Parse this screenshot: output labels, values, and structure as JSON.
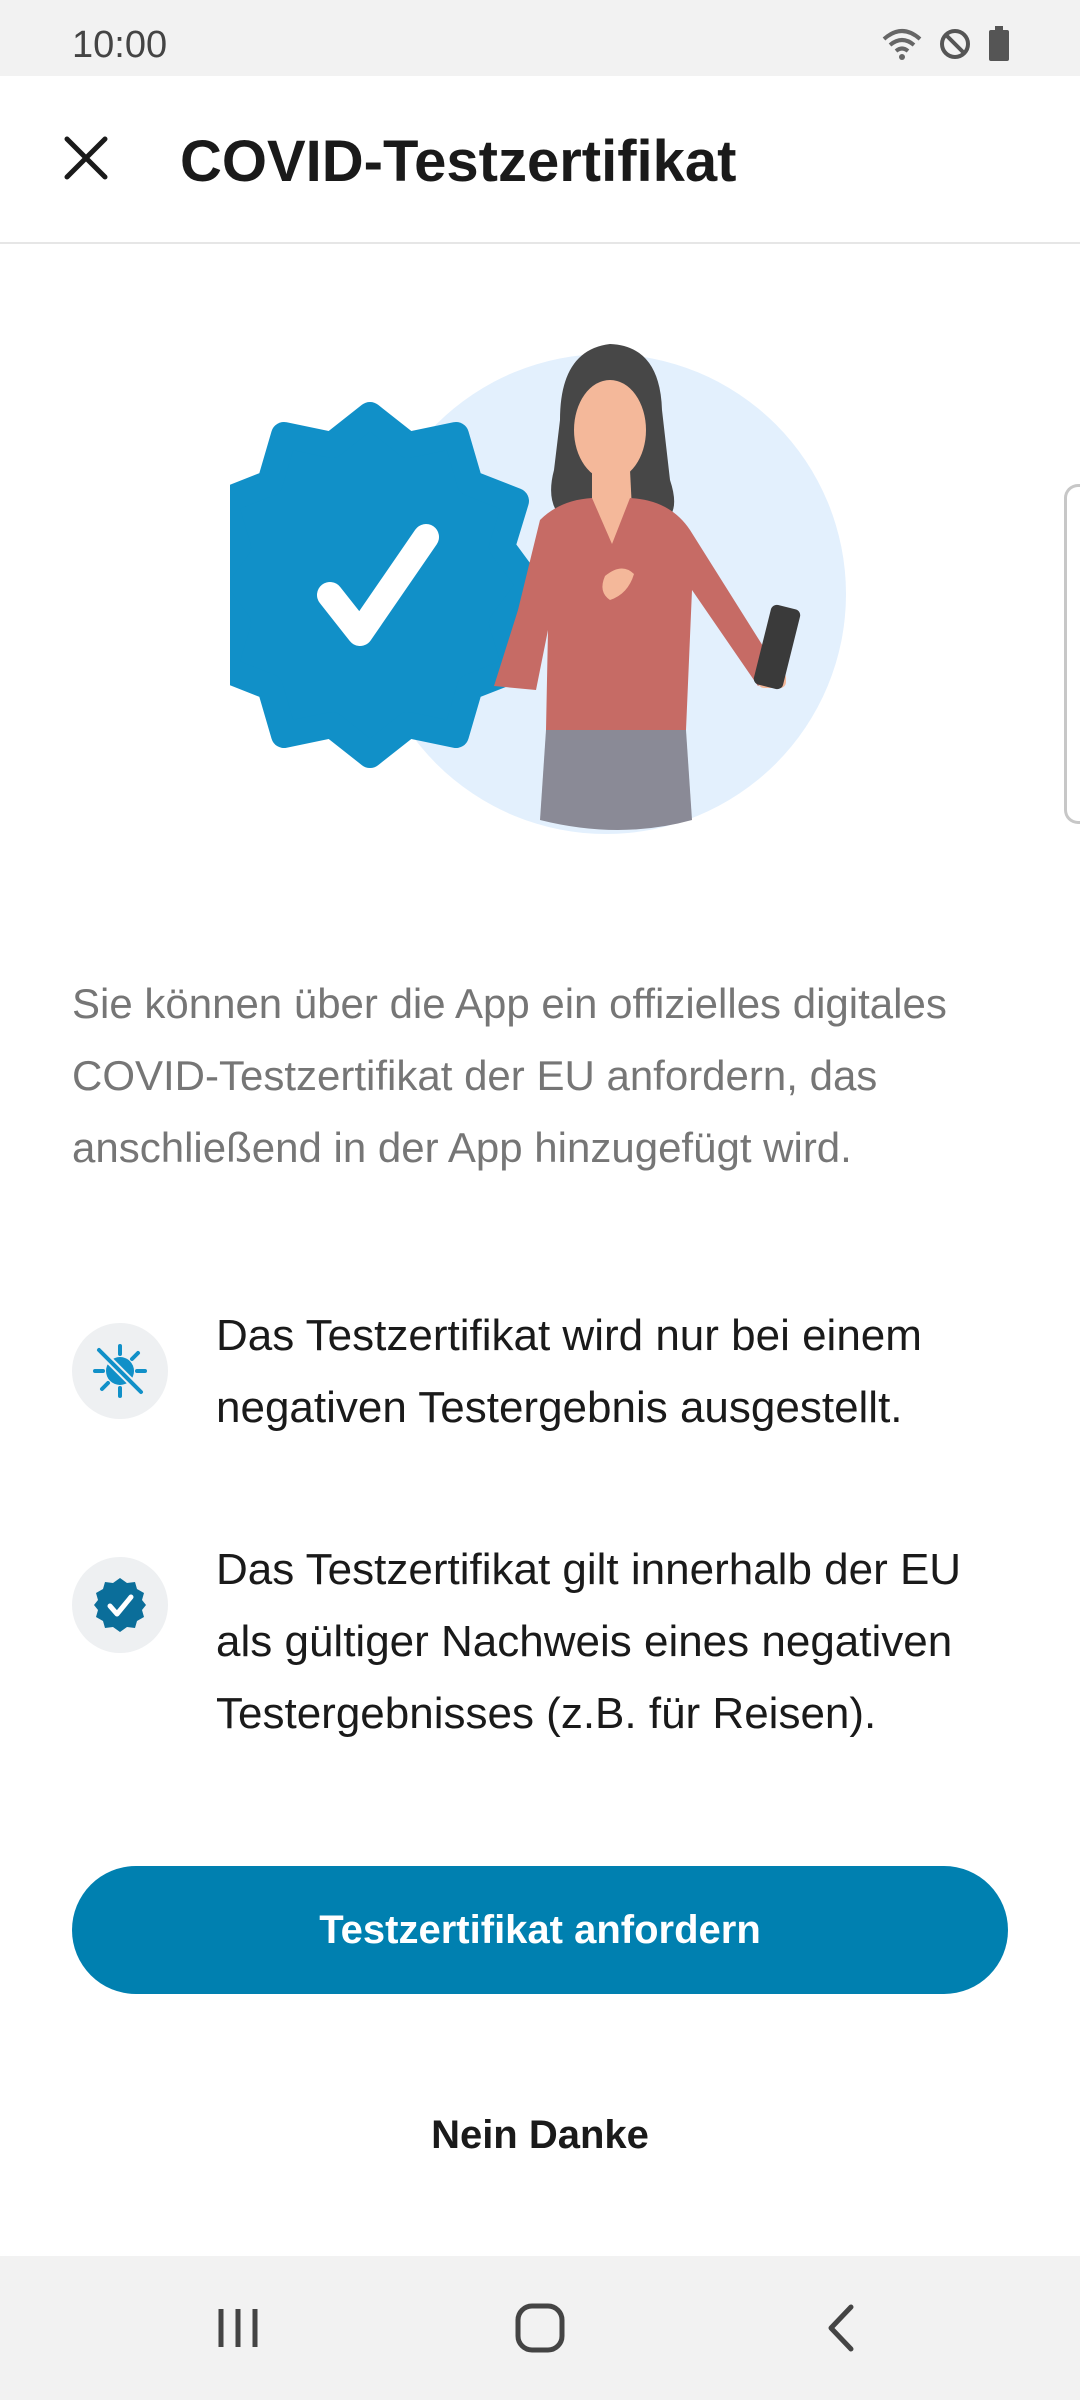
{
  "status_bar": {
    "time": "10:00",
    "icons": [
      "wifi-icon",
      "do-not-disturb-icon",
      "battery-icon"
    ]
  },
  "app_bar": {
    "title": "COVID-Testzertifikat",
    "close_icon": "close-icon"
  },
  "intro_text": "Sie können über die App ein offizielles digitales COVID-Testzertifikat der EU anfordern, das anschließend in der App hinzugefügt wird.",
  "info_items": [
    {
      "icon": "virus-crossed-icon",
      "text": "Das Testzertifikat wird nur bei einem negativen Testergebnis ausgestellt."
    },
    {
      "icon": "verified-badge-icon",
      "text": "Das Testzertifikat gilt innerhalb der EU als gültiger Nachweis eines negativen Testergebnisses (z.B. für Reisen)."
    }
  ],
  "buttons": {
    "primary": "Testzertifikat anfordern",
    "secondary": "Nein Danke"
  },
  "colors": {
    "accent": "#0080b0",
    "badge": "#1190c8",
    "hero_circle": "#e3f0fd"
  },
  "nav_bar": {
    "icons": [
      "recent-apps-icon",
      "home-icon",
      "back-icon"
    ]
  }
}
